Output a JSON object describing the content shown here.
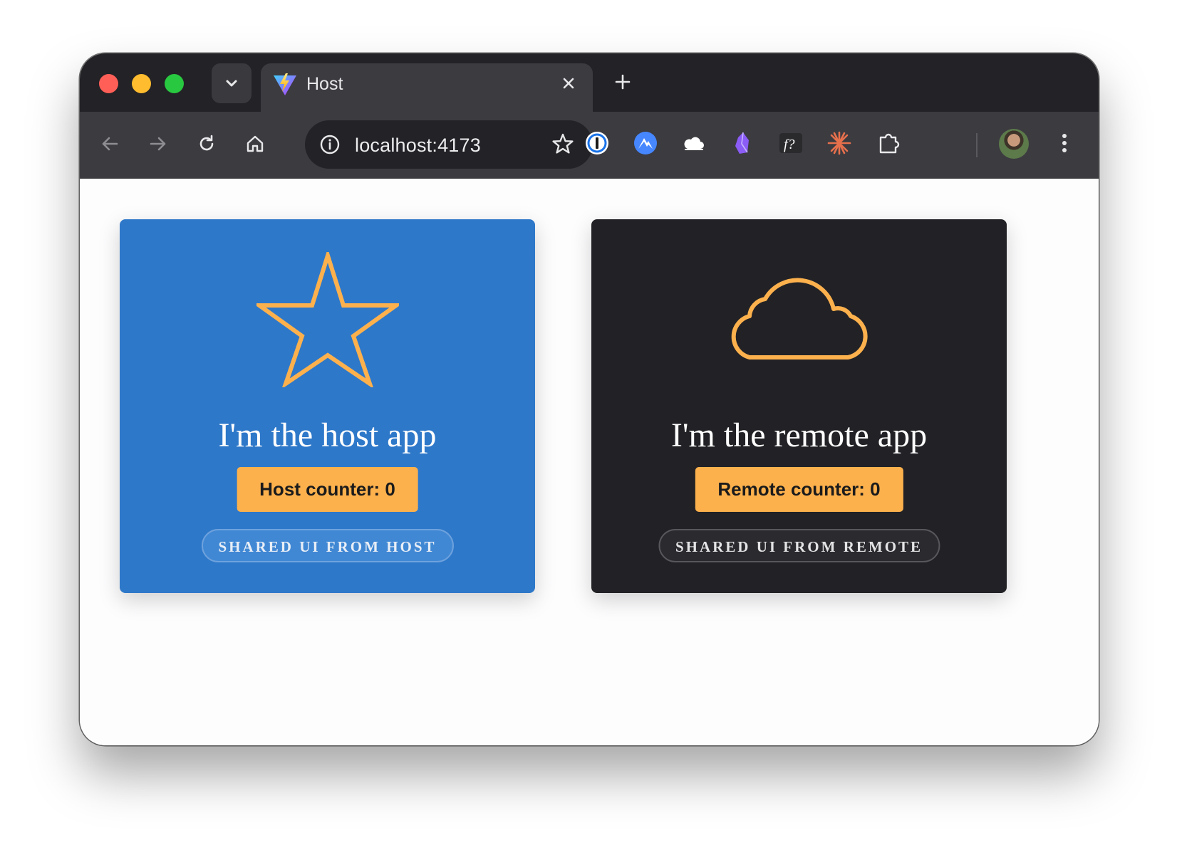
{
  "browser": {
    "tab": {
      "title": "Host",
      "favicon": "vite-logo-icon"
    },
    "address_bar": {
      "url": "localhost:4173"
    },
    "extensions": [
      "1password-icon",
      "nordvpn-icon",
      "cloud-icon",
      "obsidian-icon",
      "font-identifier-icon",
      "claude-sparkle-icon",
      "puzzle-piece-icon"
    ]
  },
  "cards": {
    "host": {
      "icon": "star-icon",
      "title": "I'm the host app",
      "counter_label": "Host counter: 0",
      "shared_label": "SHARED UI FROM HOST",
      "background": "#2e78c9"
    },
    "remote": {
      "icon": "cloud-icon",
      "title": "I'm the remote app",
      "counter_label": "Remote counter: 0",
      "shared_label": "SHARED UI FROM REMOTE",
      "background": "#222226"
    }
  },
  "colors": {
    "accent": "#fdb14d",
    "titlebar": "#232226",
    "toolbar": "#3c3b40"
  }
}
